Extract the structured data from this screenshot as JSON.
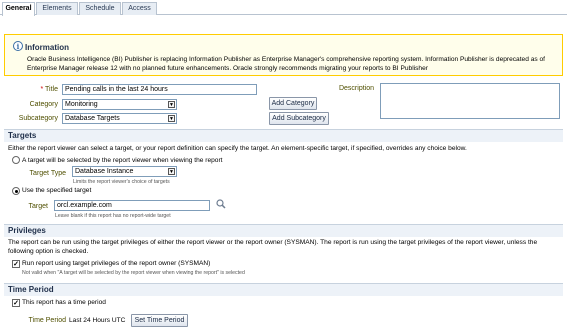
{
  "tabs": [
    {
      "label": "General",
      "active": true
    },
    {
      "label": "Elements",
      "active": false
    },
    {
      "label": "Schedule",
      "active": false
    },
    {
      "label": "Access",
      "active": false
    }
  ],
  "info": {
    "icon": "info-icon",
    "title": "Information",
    "text": "Oracle Business Intelligence (BI) Publisher is replacing Information Publisher as Enterprise Manager's comprehensive reporting system. Information Publisher is deprecated as of Enterprise Manager release 12 with no planned future enhancements. Oracle strongly recommends migrating your reports to BI Publisher"
  },
  "general": {
    "title_label": "Title",
    "title_required": "*",
    "title_value": "Pending calls in the last 24 hours",
    "category_label": "Category",
    "category_value": "Monitoring",
    "subcategory_label": "Subcategory",
    "subcategory_value": "Database Targets",
    "add_category_label": "Add Category",
    "add_subcategory_label": "Add Subcategory",
    "description_label": "Description",
    "description_value": ""
  },
  "targets": {
    "header": "Targets",
    "intro": "Either the report viewer can select a target, or your report definition can specify the target. An element-specific target, if specified, overrides any choice below.",
    "option_viewer_label": "A target will be selected by the report viewer when viewing the report",
    "target_type_label": "Target Type",
    "target_type_value": "Database Instance",
    "target_type_hint": "Limits the report viewer's choice of targets",
    "option_specified_label": "Use the specified target",
    "target_label": "Target",
    "target_value": "orcl.example.com",
    "target_hint": "Leave blank if this report has no report-wide target",
    "selected_option": "specified"
  },
  "privileges": {
    "header": "Privileges",
    "intro": "The report can be run using the target privileges of either the report viewer or the report owner (SYSMAN). The report is run using the target privileges of the report viewer, unless the following option is checked.",
    "checkbox_label": "Run report using target privileges of the report owner (SYSMAN)",
    "checkbox_checked": true,
    "hint": "Not valid when \"A target will be selected by the report viewer when viewing the report\" is selected"
  },
  "time_period": {
    "header": "Time Period",
    "checkbox_label": "This report has a time period",
    "checkbox_checked": true,
    "label": "Time Period",
    "value": "Last 24 Hours UTC",
    "button_label": "Set Time Period"
  }
}
